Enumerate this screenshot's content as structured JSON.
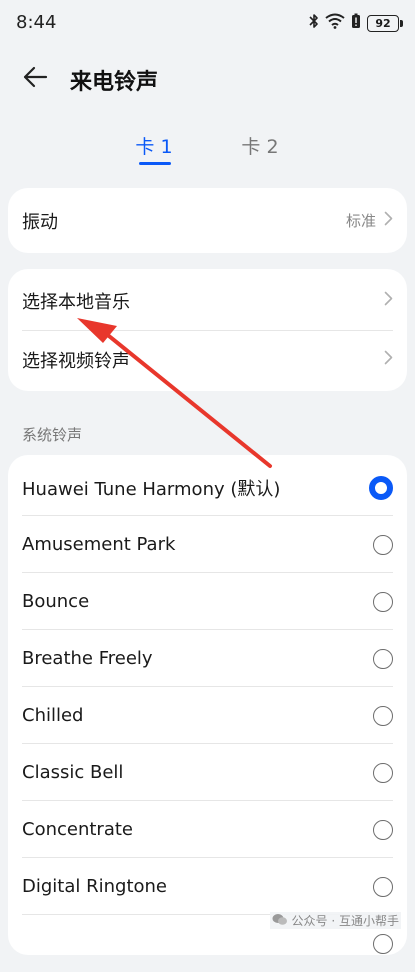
{
  "status_bar": {
    "time": "8:44",
    "battery": "92"
  },
  "header": {
    "title": "来电铃声"
  },
  "tabs": [
    {
      "label": "卡 1"
    },
    {
      "label": "卡 2"
    }
  ],
  "vibration": {
    "label": "振动",
    "value": "标准"
  },
  "local": {
    "items": [
      {
        "label": "选择本地音乐"
      },
      {
        "label": "选择视频铃声"
      }
    ]
  },
  "system_ringtones": {
    "section_label": "系统铃声",
    "items": [
      {
        "label": "Huawei Tune Harmony (默认)",
        "selected": true
      },
      {
        "label": "Amusement Park",
        "selected": false
      },
      {
        "label": "Bounce",
        "selected": false
      },
      {
        "label": "Breathe Freely",
        "selected": false
      },
      {
        "label": "Chilled",
        "selected": false
      },
      {
        "label": "Classic Bell",
        "selected": false
      },
      {
        "label": "Concentrate",
        "selected": false
      },
      {
        "label": "Digital Ringtone",
        "selected": false
      }
    ]
  },
  "watermark": {
    "text": "公众号 · 互通小帮手"
  },
  "colors": {
    "accent": "#0a59f7",
    "annotation_arrow": "#e8372c",
    "background": "#f1f3f5"
  }
}
